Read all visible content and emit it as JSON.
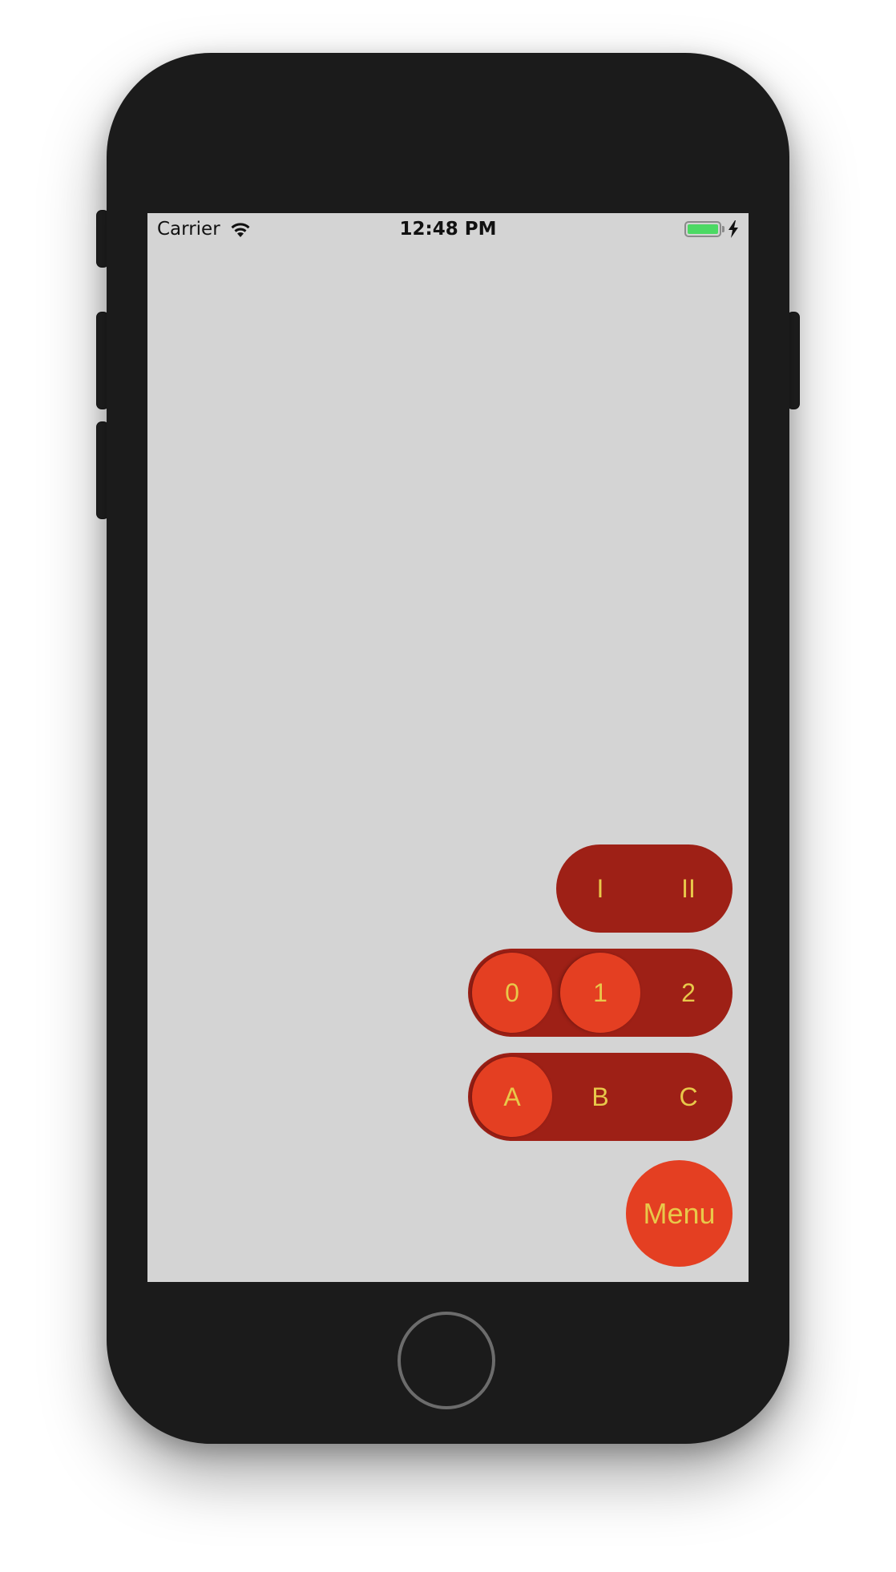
{
  "status_bar": {
    "carrier": "Carrier",
    "time": "12:48 PM",
    "wifi_icon": "wifi-icon",
    "battery_icon": "battery-charging-icon",
    "battery_color": "#4cd964"
  },
  "menus": {
    "roman": {
      "options": [
        "I",
        "II"
      ]
    },
    "numbers": {
      "options": [
        "0",
        "1",
        "2"
      ]
    },
    "letters": {
      "options": [
        "A",
        "B",
        "C"
      ]
    },
    "menu_button": {
      "label": "Menu"
    }
  },
  "colors": {
    "screen_background": "#d4d4d4",
    "pill_background": "#9e2016",
    "selected_option": "#e43f22",
    "option_text": "#e8c84a",
    "phone_body": "#1b1b1b"
  }
}
